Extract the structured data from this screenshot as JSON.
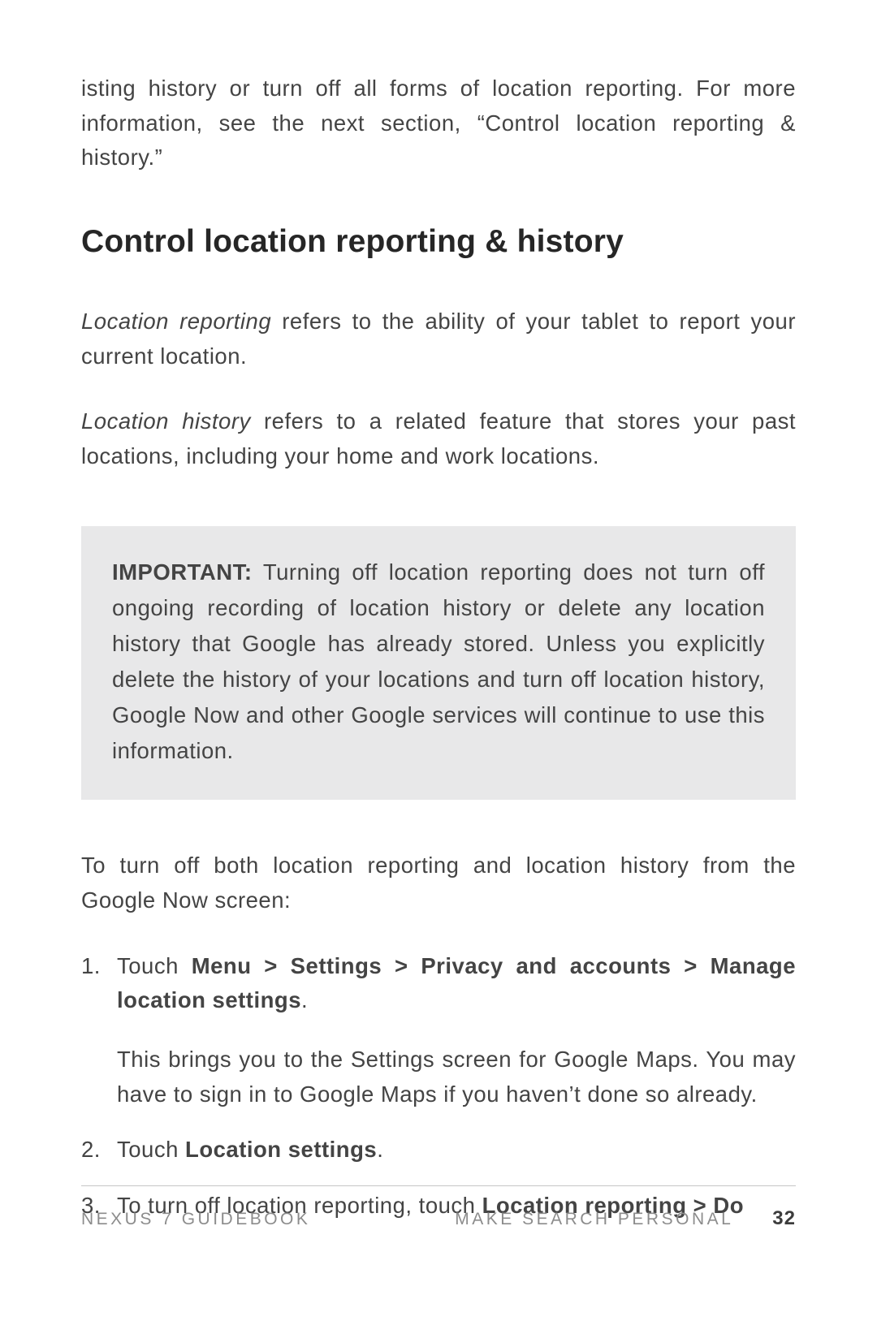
{
  "intro": "isting history or turn off all forms of location reporting. For more information, see the next section, “Control location reporting & history.”",
  "heading": "Control location reporting & history",
  "def1_term": "Location reporting",
  "def1_rest": " refers to the ability of your tablet to report your current location.",
  "def2_term": "Location history",
  "def2_rest": " refers to a related feature that stores your past locations, including your home and work locations.",
  "callout_label": "IMPORTANT:",
  "callout_body": " Turning off location reporting does not turn off ongoing recording of location history or delete any lo­cation history that Google has already stored. Unless you explicitly delete the history of your locations and turn off location history, Google Now and other Google services will continue to use this information.",
  "list_lead": "To turn off both location reporting and location history from the Google Now screen:",
  "steps": {
    "s1_prefix": "Touch ",
    "s1_bold": "Menu > Settings > Privacy and accounts > Manage loca­tion settings",
    "s1_suffix": ".",
    "s1_note": "This brings you to the Settings screen for Google Maps. You may have to sign in to Google Maps if you haven’t done so already.",
    "s2_prefix": "Touch ",
    "s2_bold": "Location settings",
    "s2_suffix": ".",
    "s3_prefix": "To turn off location reporting, touch ",
    "s3_bold": "Location reporting > Do"
  },
  "footer": {
    "left": "NEXUS 7 GUIDEBOOK",
    "center": "MAKE SEARCH PERSONAL",
    "page": "32"
  }
}
